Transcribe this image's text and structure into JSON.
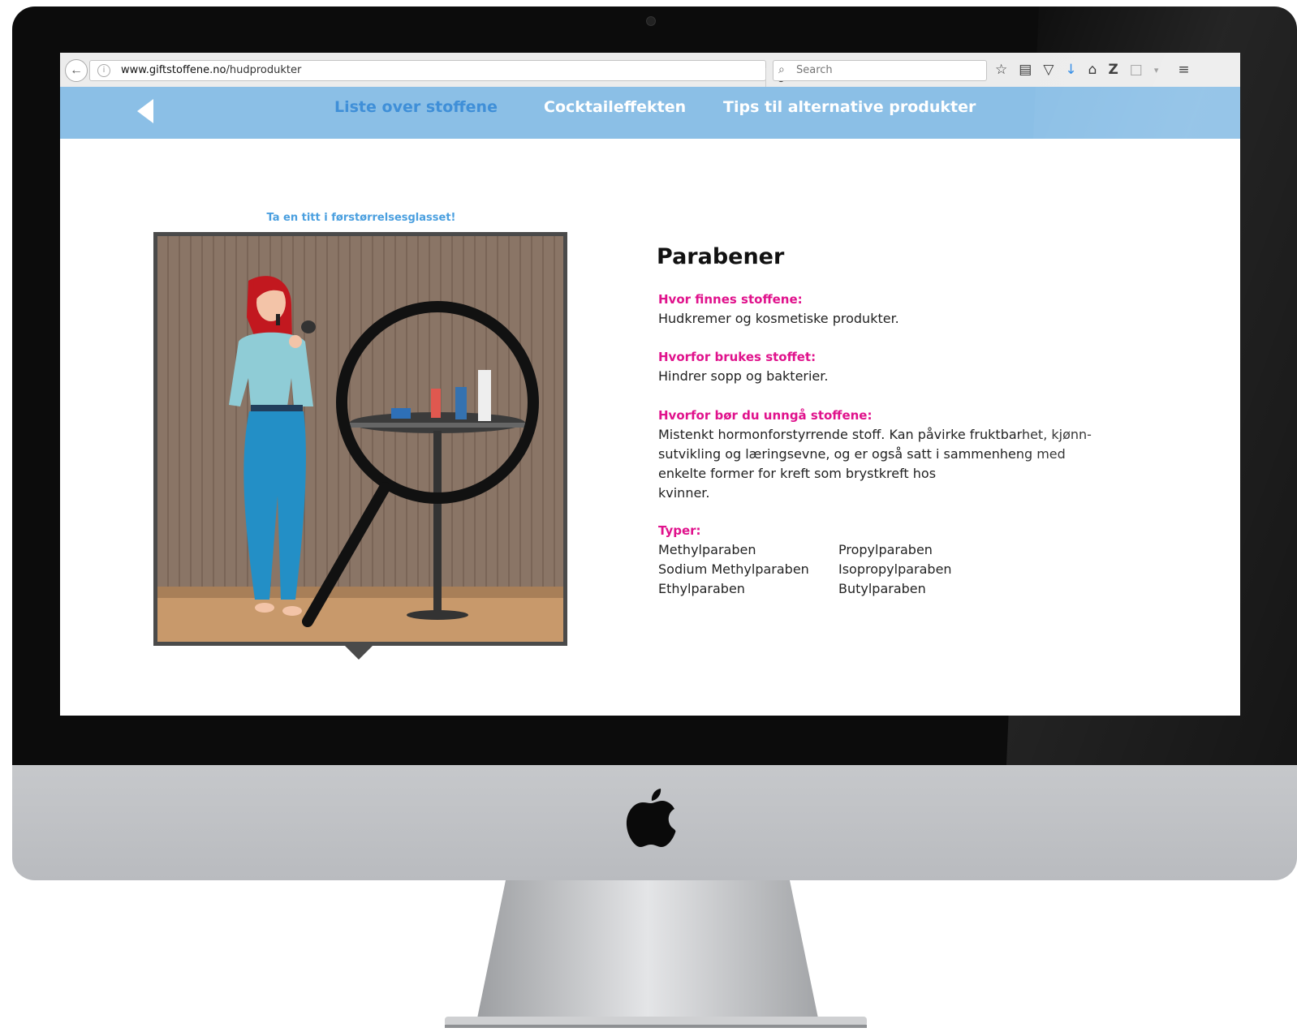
{
  "browser": {
    "url_domain": "www.giftstoffene.no",
    "url_path": "/hudprodukter",
    "search_placeholder": "Search"
  },
  "site_nav": {
    "items": [
      {
        "label": "Liste over stoffene",
        "active": true
      },
      {
        "label": "Cocktaileffekten",
        "active": false
      },
      {
        "label": "Tips til alternative produkter",
        "active": false
      }
    ]
  },
  "illustration": {
    "caption": "Ta en titt i førstørrelsesglasset!"
  },
  "article": {
    "title": "Parabener",
    "where_label": "Hvor finnes stoffene:",
    "where_text": "Hudkremer og kosmetiske produkter.",
    "why_used_label": "Hvorfor brukes stoffet:",
    "why_used_text": "Hindrer sopp og bakterier.",
    "why_avoid_label": "Hvorfor bør du unngå stoffene:",
    "why_avoid_lines": [
      "Mistenkt hormonforstyrrende stoff. Kan påvirke fruktbarhet, kjønn-",
      "sutvikling og læringsevne, og er også satt i sammenheng med",
      "enkelte former for kreft som brystkreft hos",
      "kvinner."
    ],
    "types_label": "Typer:",
    "types_col1": [
      "Methylparaben",
      "Sodium Methylparaben",
      "Ethylparaben"
    ],
    "types_col2": [
      "Propylparaben",
      "Isopropylparaben",
      "Butylparaben"
    ]
  },
  "colors": {
    "nav_bg": "#8bbfe6",
    "nav_active": "#3f8fd8",
    "label_pink": "#e0128c",
    "caption_blue": "#4a9fdf"
  },
  "icons": [
    "back-arrow-icon",
    "info-icon",
    "reload-icon",
    "search-icon",
    "bookmark-star-icon",
    "reading-list-icon",
    "pocket-icon",
    "download-icon",
    "home-icon",
    "zotero-icon",
    "menu-icon",
    "apple-logo-icon"
  ]
}
